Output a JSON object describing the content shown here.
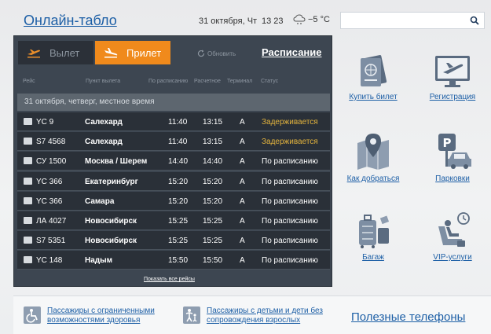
{
  "header": {
    "title": "Онлайн-табло",
    "date": "31 октября, Чт",
    "time": "13 23",
    "weather": "−5 °С",
    "search_placeholder": ""
  },
  "board": {
    "tab_departure": "Вылет",
    "tab_arrival": "Прилет",
    "active_tab": "Прилет",
    "refresh_label": "Обновить",
    "schedule_link": "Расписание",
    "columns": {
      "flight": "Рейс",
      "origin": "Пункт вылета",
      "scheduled": "По расписанию",
      "estimated": "Расчетное",
      "terminal": "Терминал",
      "status": "Статус"
    },
    "date_row": "31 октября, четверг, местное время",
    "flights": [
      {
        "flight": "YC 9",
        "origin": "Салехард",
        "scheduled": "11:40",
        "estimated": "13:15",
        "terminal": "A",
        "status": "Задерживается"
      },
      {
        "flight": "S7 4568",
        "origin": "Салехард",
        "scheduled": "11:40",
        "estimated": "13:15",
        "terminal": "A",
        "status": "Задерживается"
      },
      {
        "flight": "СУ 1500",
        "origin": "Москва / Шерем",
        "scheduled": "14:40",
        "estimated": "14:40",
        "terminal": "A",
        "status": "По расписанию"
      },
      {
        "flight": "YC 366",
        "origin": "Екатеринбург",
        "scheduled": "15:20",
        "estimated": "15:20",
        "terminal": "A",
        "status": "По расписанию"
      },
      {
        "flight": "YC 366",
        "origin": "Самара",
        "scheduled": "15:20",
        "estimated": "15:20",
        "terminal": "A",
        "status": "По расписанию"
      },
      {
        "flight": "ЛА 4027",
        "origin": "Новосибирск",
        "scheduled": "15:25",
        "estimated": "15:25",
        "terminal": "A",
        "status": "По расписанию"
      },
      {
        "flight": "S7 5351",
        "origin": "Новосибирск",
        "scheduled": "15:25",
        "estimated": "15:25",
        "terminal": "A",
        "status": "По расписанию"
      },
      {
        "flight": "YC 148",
        "origin": "Надым",
        "scheduled": "15:50",
        "estimated": "15:50",
        "terminal": "A",
        "status": "По расписанию"
      }
    ],
    "show_all": "Показать все рейсы"
  },
  "services": {
    "buy_ticket": "Купить билет",
    "checkin": "Регистрация",
    "directions": "Как добраться",
    "parking": "Парковки",
    "baggage": "Багаж",
    "vip": "VIP-услуги"
  },
  "footer": {
    "disabled_info": "Пассажиры с ограниченными возможностями здоровья",
    "children_info": "Пассажиры с детьми и дети без сопровождения взрослых",
    "useful_phones": "Полезные телефоны"
  },
  "colors": {
    "accent_orange": "#f08a1c",
    "link_blue": "#1d5fa6",
    "board_bg": "#3d4651",
    "delayed": "#e3b33d"
  }
}
